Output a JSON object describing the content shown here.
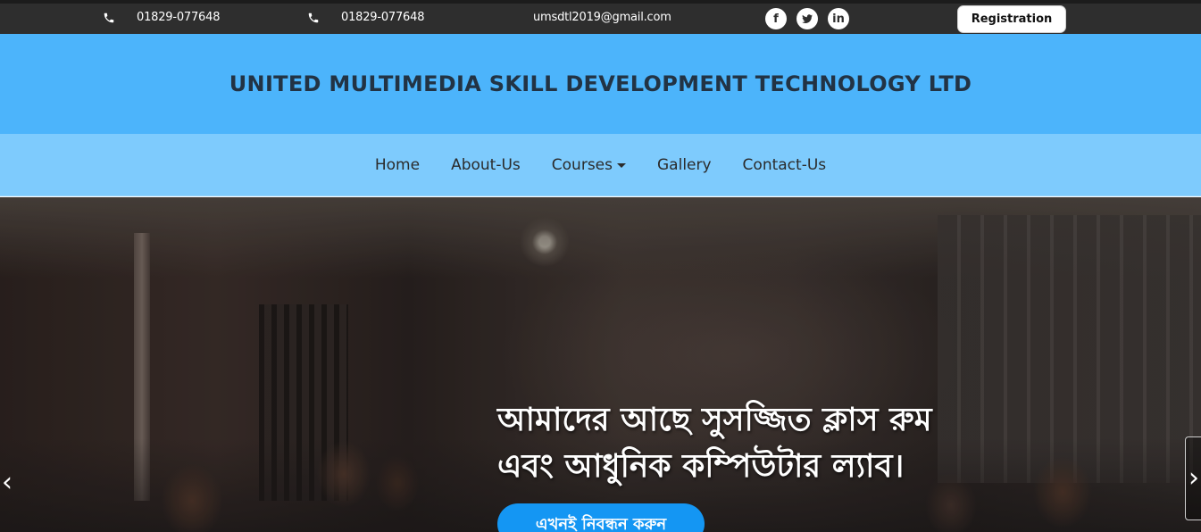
{
  "topbar": {
    "phone_1": "01829-077648",
    "phone_2": "01829-077648",
    "email": "umsdtl2019@gmail.com",
    "socials": [
      {
        "name": "facebook",
        "icon": "facebook-icon",
        "glyph": "f"
      },
      {
        "name": "twitter",
        "icon": "twitter-icon"
      },
      {
        "name": "linkedin",
        "icon": "linkedin-icon",
        "glyph": "in"
      }
    ],
    "registration_label": "Registration"
  },
  "brand": {
    "title": "UNITED MULTIMEDIA SKILL DEVELOPMENT TECHNOLOGY LTD"
  },
  "nav": {
    "items": [
      {
        "label": "Home"
      },
      {
        "label": "About-Us"
      },
      {
        "label": "Courses",
        "has_dropdown": true
      },
      {
        "label": "Gallery"
      },
      {
        "label": "Contact-Us"
      }
    ]
  },
  "hero": {
    "caption_line_1": "আমাদের আছে সুসজ্জিত ক্লাস রুম",
    "caption_line_2": "এবং আধুনিক কম্পিউটার ল্যাব।",
    "cta_label": "এখনই নিবন্ধন করুন",
    "prev_glyph": "‹",
    "next_glyph": "›"
  },
  "colors": {
    "topbar_bg": "#2e2e2e",
    "brand_bg": "#4cb4fb",
    "nav_bg": "#7ecbfd",
    "cta_bg": "#1496f3"
  }
}
